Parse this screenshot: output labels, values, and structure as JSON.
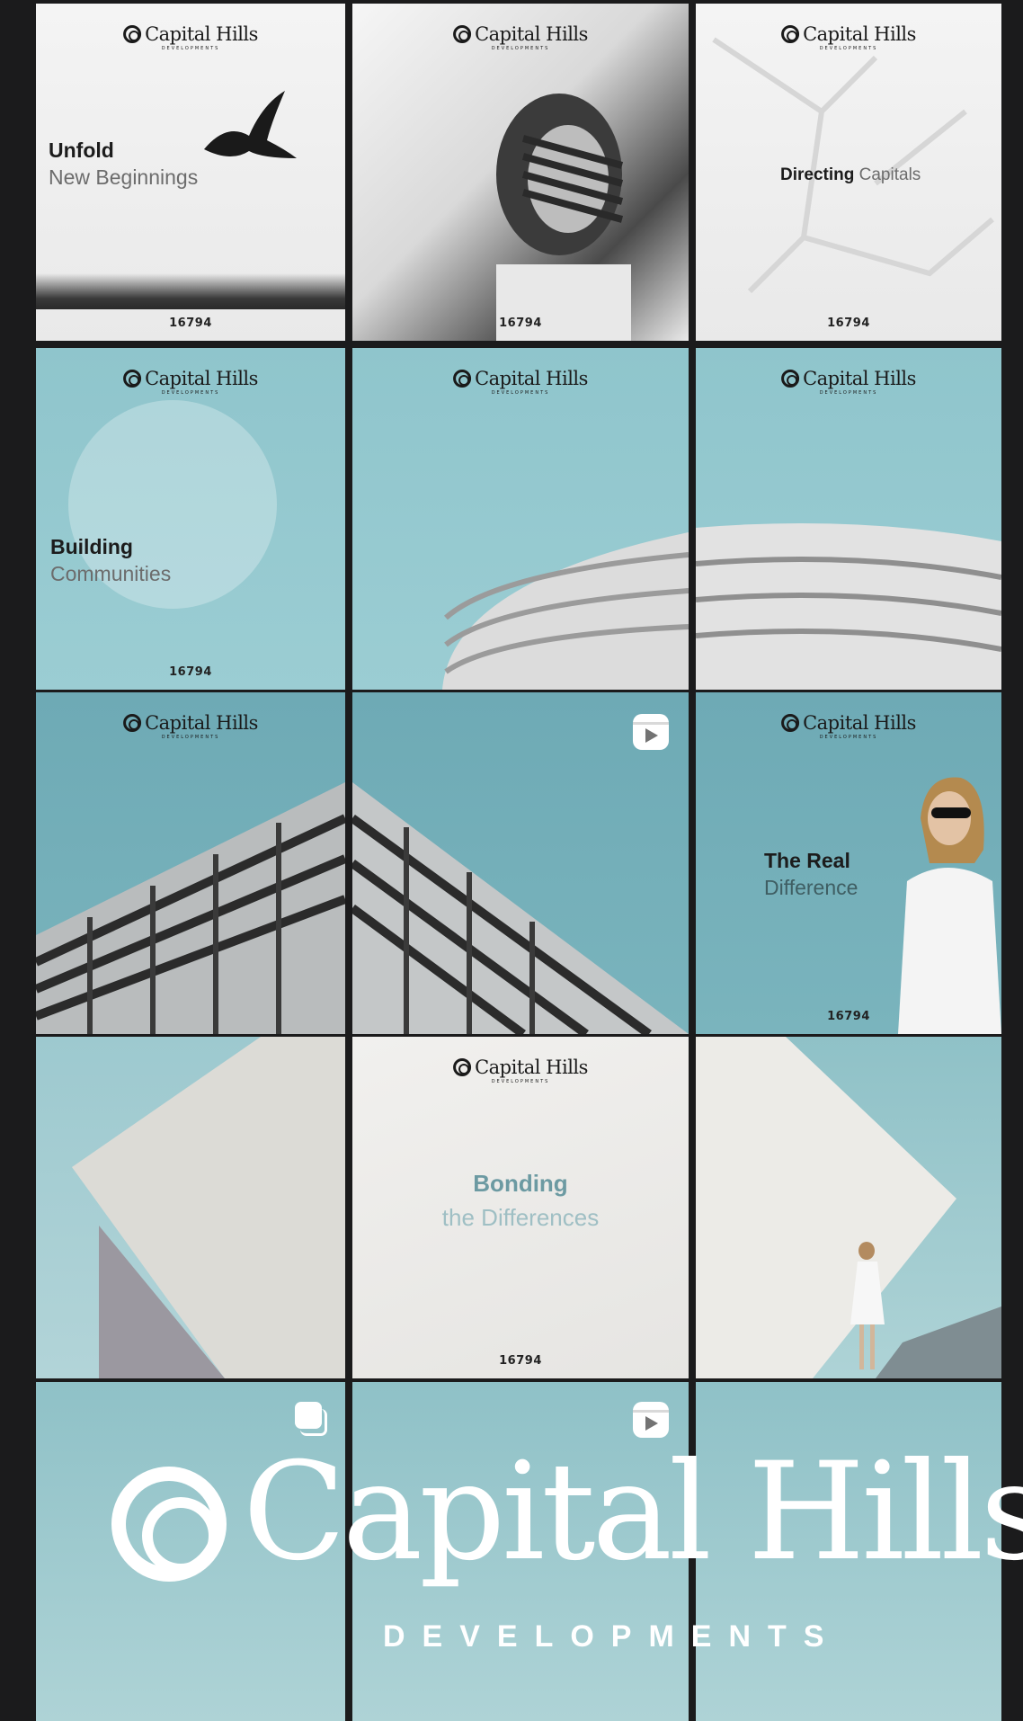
{
  "brand": {
    "name": "Capital Hills",
    "sub": "DEVELOPMENTS"
  },
  "posts": {
    "p1": {
      "line1": "Unfold",
      "line2": "New Beginnings",
      "code": "16794"
    },
    "p2": {
      "code": "16794"
    },
    "p3": {
      "line1": "Directing",
      "line2": "Capitals",
      "code": "16794"
    },
    "p4": {
      "line1": "Building",
      "line2": "Communities",
      "code": "16794"
    },
    "p9": {
      "line1": "The Real",
      "line2": "Difference",
      "code": "16794"
    },
    "p11": {
      "line1": "Bonding",
      "line2": "the Differences",
      "code": "16794"
    }
  },
  "icons": {
    "reel": "reel-icon",
    "carousel": "carousel-icon"
  },
  "colors": {
    "teal": "#7ab4bd",
    "background": "#1b1b1c"
  }
}
